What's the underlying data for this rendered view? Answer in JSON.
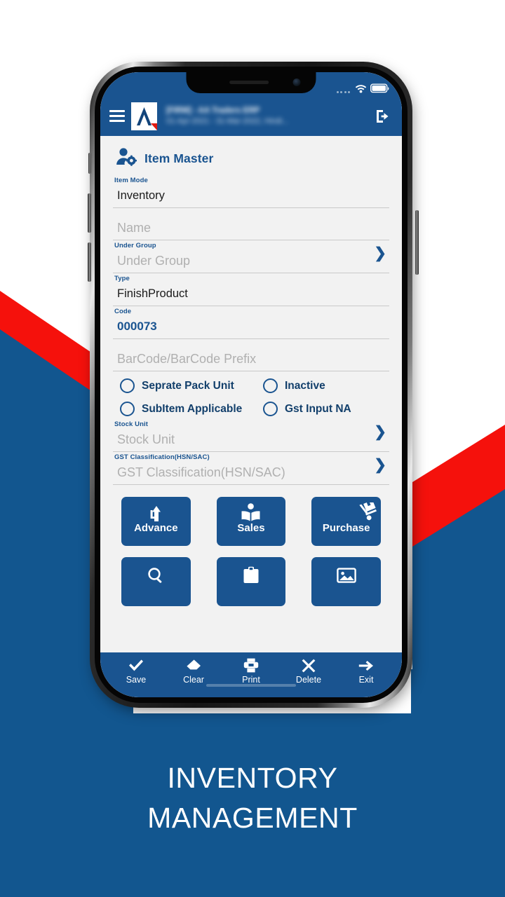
{
  "caption": {
    "line1": "INVENTORY",
    "line2": "MANAGEMENT"
  },
  "colors": {
    "brand_blue": "#1a5490",
    "bg_blue": "#12568f",
    "accent_red": "#f5110c",
    "screen_bg": "#f2f2f2",
    "label_blue": "#1a5490",
    "placeholder_gray": "#b0b0b0"
  },
  "statusbar": {
    "signal_icon": "signal-dots-icon",
    "wifi_icon": "wifi-icon",
    "battery_icon": "battery-full-icon"
  },
  "appbar": {
    "menu_icon": "hamburger-menu-icon",
    "logo_icon": "app-logo-icon",
    "title_line1": "[FIRM] - AA Traders ERP",
    "title_line2": "01-Apr-2021 - 31-Mar-2022, Hindi...",
    "logout_icon": "logout-icon"
  },
  "page": {
    "icon": "user-settings-icon",
    "title": "Item Master"
  },
  "fields": [
    {
      "label": "Item Mode",
      "value": "Inventory",
      "placeholder": "",
      "state": "value",
      "chevron": false
    },
    {
      "label": "",
      "value": "",
      "placeholder": "Name",
      "state": "placeholder",
      "chevron": false
    },
    {
      "label": "Under Group",
      "value": "",
      "placeholder": "Under Group",
      "state": "placeholder",
      "chevron": true
    },
    {
      "label": "Type",
      "value": "FinishProduct",
      "placeholder": "",
      "state": "value",
      "chevron": false
    },
    {
      "label": "Code",
      "value": "000073",
      "placeholder": "",
      "state": "code",
      "chevron": false
    },
    {
      "label": "",
      "value": "",
      "placeholder": "BarCode/BarCode Prefix",
      "state": "placeholder",
      "chevron": false
    },
    {
      "label": "Stock Unit",
      "value": "",
      "placeholder": "Stock Unit",
      "state": "placeholder",
      "chevron": true
    },
    {
      "label": "GST Classification(HSN/SAC)",
      "value": "",
      "placeholder": "GST Classification(HSN/SAC)",
      "state": "placeholder",
      "chevron": true
    }
  ],
  "checkboxes": [
    {
      "label": "Seprate Pack Unit",
      "checked": false
    },
    {
      "label": "Inactive",
      "checked": false
    },
    {
      "label": "SubItem Applicable",
      "checked": false
    },
    {
      "label": "Gst Input NA",
      "checked": false
    }
  ],
  "tiles": [
    {
      "label": "Advance",
      "icon": "advance-arrow-icon"
    },
    {
      "label": "Sales",
      "icon": "sales-book-icon"
    },
    {
      "label": "Purchase",
      "icon": "purchase-handtruck-icon"
    },
    {
      "label": "",
      "icon": "search-circle-icon"
    },
    {
      "label": "",
      "icon": "clipboard-icon"
    },
    {
      "label": "",
      "icon": "image-icon"
    }
  ],
  "bottombar": [
    {
      "label": "Save",
      "icon": "check-icon"
    },
    {
      "label": "Clear",
      "icon": "eraser-icon"
    },
    {
      "label": "Print",
      "icon": "printer-icon"
    },
    {
      "label": "Delete",
      "icon": "close-x-icon"
    },
    {
      "label": "Exit",
      "icon": "arrow-right-icon"
    }
  ]
}
